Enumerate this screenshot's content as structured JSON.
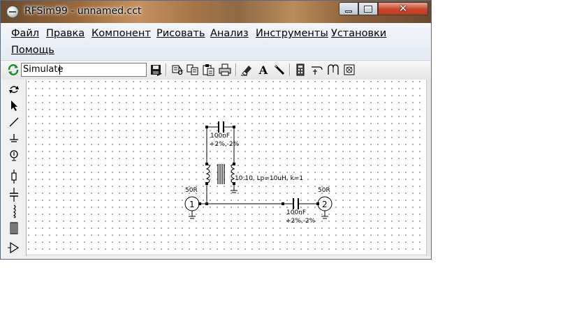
{
  "window": {
    "title": "RFSim99 - unnamed.cct"
  },
  "menu": {
    "items": [
      {
        "label": "Файл"
      },
      {
        "label": "Правка"
      },
      {
        "label": "Компонент"
      },
      {
        "label": "Рисовать"
      },
      {
        "label": "Анализ"
      },
      {
        "label": "Инструменты"
      },
      {
        "label": "Установки"
      },
      {
        "label": "Помощь"
      }
    ]
  },
  "toolbar": {
    "simulate_value": "Simulate",
    "icons": [
      "refresh-icon",
      "dropdown-arrow-icon",
      "save-icon",
      "cut-icon",
      "copy-icon",
      "paste-icon",
      "print-icon",
      "eraser-icon",
      "text-icon",
      "pencil-icon",
      "calculator-icon",
      "line-tool-icon",
      "inductor-tool-icon",
      "smith-chart-icon"
    ]
  },
  "palette": {
    "icons": [
      "rotate-icon",
      "select-arrow-icon",
      "wire-icon",
      "ground-icon",
      "port-icon",
      "resistor-icon",
      "capacitor-icon",
      "inductor-icon",
      "transformer-icon",
      "amplifier-icon"
    ]
  },
  "schematic": {
    "cap_top_value": "100nF",
    "cap_top_tol": "+2%,-2%",
    "transformer_label": "10:10, Lp=10uH, k=1",
    "port1_impedance": "50R",
    "port1_number": "1",
    "port2_impedance": "50R",
    "port2_number": "2",
    "cap_right_value": "100nF",
    "cap_right_tol": "+2%,-2%"
  }
}
